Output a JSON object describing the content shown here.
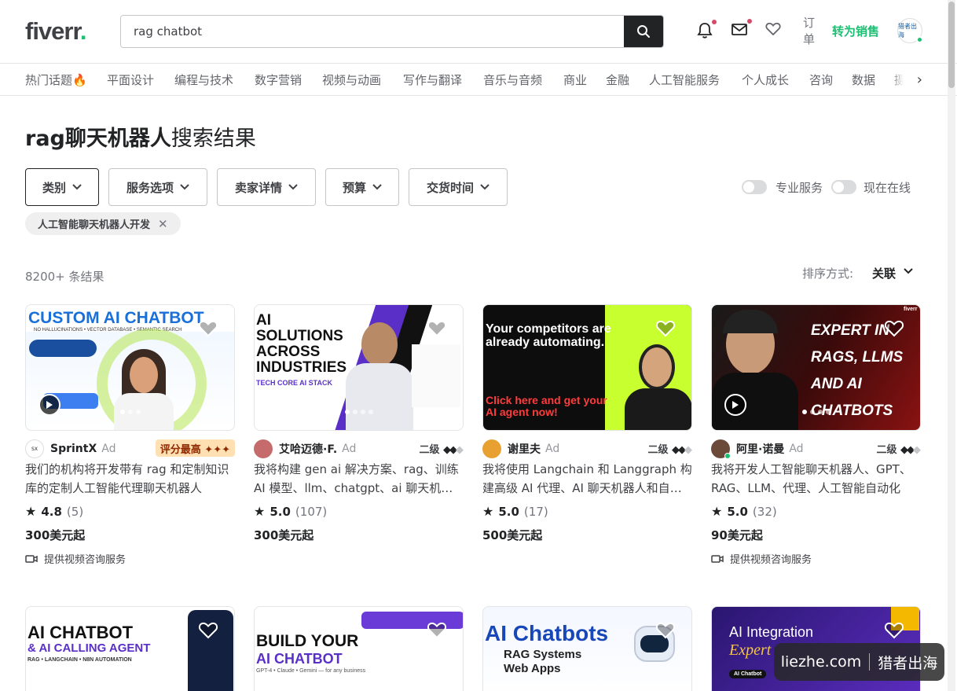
{
  "header": {
    "logo_text": "fiverr",
    "logo_dot": ".",
    "search_value": "rag chatbot",
    "orders_label": "订单",
    "become_seller": "转为销售",
    "avatar_text": "猎者出海"
  },
  "categories": [
    "热门话题🔥",
    "平面设计",
    "编程与技术",
    "数字营销",
    "视频与动画",
    "写作与翻译",
    "音乐与音频",
    "商业",
    "金融",
    "人工智能服务",
    "个人成长",
    "咨询",
    "数据",
    "摄"
  ],
  "page": {
    "title_bold": "rag聊天机器人",
    "title_rest": "搜索结果",
    "filters": [
      "类别",
      "服务选项",
      "卖家详情",
      "预算",
      "交货时间"
    ],
    "toggle_pro": "专业服务",
    "toggle_online": "现在在线",
    "chip": "人工智能聊天机器人开发",
    "results_count": "8200+ 条结果",
    "sort_label": "排序方式:",
    "sort_value": "关联"
  },
  "gigs": [
    {
      "thumb_title": "CUSTOM AI CHATBOT",
      "thumb_sub": "NO HALLUCINATIONS • VECTOR DATABASE • SEMANTIC SEARCH",
      "seller": "SprintX",
      "ad": "Ad",
      "badge": "评分最高 ✦✦✦",
      "level": "",
      "desc": "我们的机构将开发带有 rag 和定制知识库的定制人工智能代理聊天机器人",
      "rating": "4.8",
      "reviews": "(5)",
      "price": "300美元起",
      "video": "提供视频咨询服务"
    },
    {
      "thumb_title": "AI SOLUTIONS ACROSS INDUSTRIES",
      "thumb_sub": "TECH CORE AI STACK",
      "seller": "艾哈迈德·F.",
      "ad": "Ad",
      "badge": "",
      "level": "二级",
      "desc": "我将构建 gen ai 解决方案、rag、训练 AI 模型、llm、chatgpt、ai 聊天机器人",
      "rating": "5.0",
      "reviews": "(107)",
      "price": "300美元起",
      "video": ""
    },
    {
      "thumb_title": "Your competitors are already automating.",
      "thumb_sub": "Click here and get your AI agent now!",
      "seller": "谢里夫",
      "ad": "Ad",
      "badge": "",
      "level": "二级",
      "desc": "我将使用 Langchain 和 Langgraph 构建高级 AI 代理、AI 聊天机器人和自动化",
      "rating": "5.0",
      "reviews": "(17)",
      "price": "500美元起",
      "video": ""
    },
    {
      "thumb_title": "EXPERT IN RAGS, LLMS AND AI CHATBOTS",
      "thumb_sub": "fiverr",
      "seller": "阿里·诺曼",
      "ad": "Ad",
      "badge": "",
      "level": "二级",
      "desc": "我将开发人工智能聊天机器人、GPT、RAG、LLM、代理、人工智能自动化",
      "rating": "5.0",
      "reviews": "(32)",
      "price": "90美元起",
      "video": "提供视频咨询服务"
    }
  ],
  "row2": [
    {
      "t1": "AI CHATBOT",
      "t2": "& AI CALLING AGENT",
      "t3": "RAG • LANGCHAIN • N8N AUTOMATION"
    },
    {
      "t1": "BUILD YOUR",
      "t2": "AI CHATBOT",
      "t3": "GPT-4 • Claude • Gemini — for any business"
    },
    {
      "t1": "AI Chatbots",
      "t2": "RAG Systems",
      "t3": "Web Apps"
    },
    {
      "t1": "AI Integration",
      "t2": "Expert",
      "t3": "AI Chatbot"
    }
  ],
  "watermark": {
    "left": "liezhe.com",
    "right": "猎者出海"
  },
  "colors": {
    "brand_green": "#1dbf73",
    "text_dark": "#222325",
    "muted": "#74767e"
  }
}
